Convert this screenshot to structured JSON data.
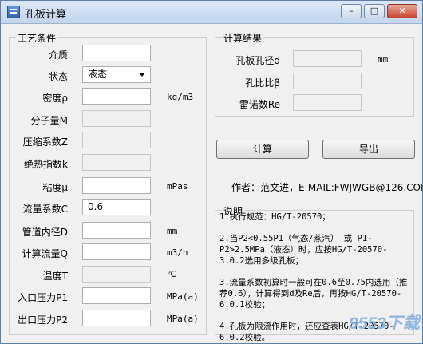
{
  "window": {
    "title": "孔板计算",
    "minimize": "–",
    "maximize": "□",
    "close": "✕"
  },
  "process": {
    "group_title": "工艺条件",
    "rows": [
      {
        "label": "介质",
        "value": "",
        "unit": ""
      },
      {
        "label": "状态",
        "value": "液态",
        "unit": ""
      },
      {
        "label": "密度ρ",
        "value": "",
        "unit": "kg/m3"
      },
      {
        "label": "分子量M",
        "value": "",
        "unit": ""
      },
      {
        "label": "压缩系数Z",
        "value": "",
        "unit": ""
      },
      {
        "label": "绝热指数k",
        "value": "",
        "unit": ""
      },
      {
        "label": "粘度μ",
        "value": "",
        "unit": "mPas"
      },
      {
        "label": "流量系数C",
        "value": "0.6",
        "unit": ""
      },
      {
        "label": "管道内径D",
        "value": "",
        "unit": "mm"
      },
      {
        "label": "计算流量Q",
        "value": "",
        "unit": "m3/h"
      },
      {
        "label": "温度T",
        "value": "",
        "unit": "℃"
      },
      {
        "label": "入口压力P1",
        "value": "",
        "unit": "MPa(a)"
      },
      {
        "label": "出口压力P2",
        "value": "",
        "unit": "MPa(a)"
      }
    ]
  },
  "results": {
    "group_title": "计算结果",
    "rows": [
      {
        "label": "孔板孔径d",
        "value": "",
        "unit": "mm"
      },
      {
        "label": "孔比比β",
        "value": "",
        "unit": ""
      },
      {
        "label": "雷诺数Re",
        "value": "",
        "unit": ""
      }
    ]
  },
  "actions": {
    "calculate": "计算",
    "export": "导出"
  },
  "author": "作者：范文进，E-MAIL:FWJWGB@126.COM",
  "notes": {
    "group_title": "说明",
    "items": [
      "1.执行规范：HG/T-20570；",
      "2.当P2<0.55P1（气态/蒸汽） 或  P1-P2>2.5MPa（液态）时，应按HG/T-20570-3.0.2选用多级孔板；",
      "3.流量系数初算时一般可在0.6至0.75内选用（推荐0.6），计算得到d及Re后，再按HG/T-20570-6.0.1校验；",
      "4.孔板为限流作用时，还应查表HG/T-20570-6.0.2校验。"
    ]
  },
  "watermark": "9553下载"
}
